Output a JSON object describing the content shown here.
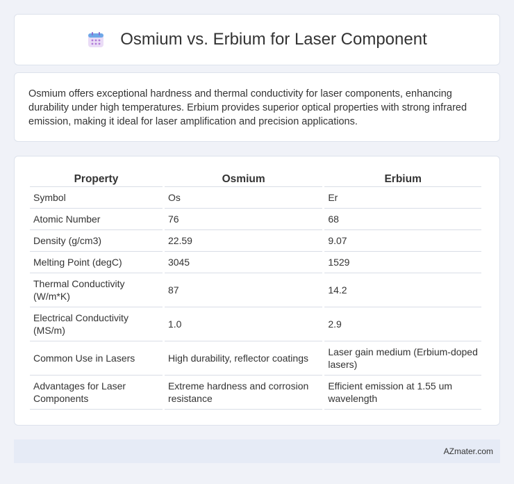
{
  "header": {
    "title": "Osmium vs. Erbium for Laser Component",
    "icon": "calendar-icon"
  },
  "intro": {
    "text": "Osmium offers exceptional hardness and thermal conductivity for laser components, enhancing durability under high temperatures. Erbium provides superior optical properties with strong infrared emission, making it ideal for laser amplification and precision applications."
  },
  "table": {
    "headers": [
      "Property",
      "Osmium",
      "Erbium"
    ],
    "rows": [
      [
        "Symbol",
        "Os",
        "Er"
      ],
      [
        "Atomic Number",
        "76",
        "68"
      ],
      [
        "Density (g/cm3)",
        "22.59",
        "9.07"
      ],
      [
        "Melting Point (degC)",
        "3045",
        "1529"
      ],
      [
        "Thermal Conductivity (W/m*K)",
        "87",
        "14.2"
      ],
      [
        "Electrical Conductivity (MS/m)",
        "1.0",
        "2.9"
      ],
      [
        "Common Use in Lasers",
        "High durability, reflector coatings",
        "Laser gain medium (Erbium-doped lasers)"
      ],
      [
        "Advantages for Laser Components",
        "Extreme hardness and corrosion resistance",
        "Efficient emission at 1.55 um wavelength"
      ]
    ]
  },
  "footer": {
    "brand": "AZmater.com"
  }
}
